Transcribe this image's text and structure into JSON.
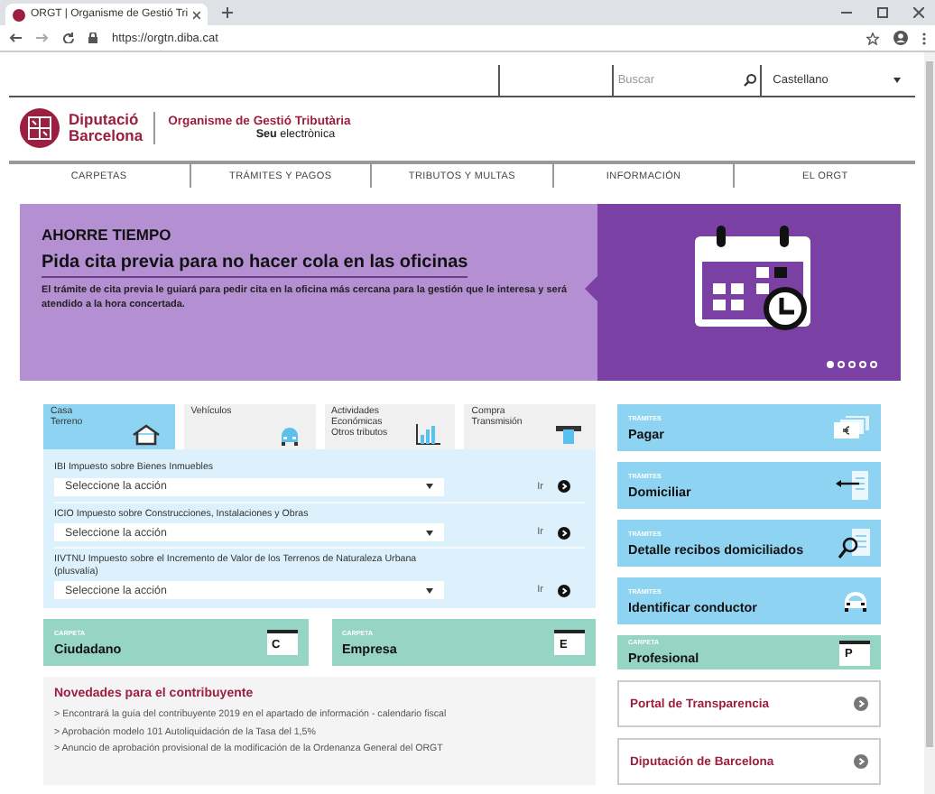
{
  "browser": {
    "tab_title": "ORGT | Organisme de Gestió Tri",
    "url": "https://orgtn.diba.cat"
  },
  "header": {
    "search": {
      "placeholder": "Buscar"
    },
    "language": "Castellano"
  },
  "logo": {
    "line1": "Diputació",
    "line2": "Barcelona",
    "org": "Organisme de Gestió Tributària",
    "seu": "**Seu** electrònica"
  },
  "nav": {
    "items": [
      {
        "label": "CARPETAS"
      },
      {
        "label": "TRÁMITES Y PAGOS"
      },
      {
        "label": "TRIBUTOS Y MULTAS"
      },
      {
        "label": "INFORMACIÓN"
      },
      {
        "label": "EL ORGT"
      }
    ]
  },
  "banner": {
    "kicker": "AHORRE TIEMPO",
    "title": "Pida cita previa para no hacer cola en las oficinas",
    "text": "El trámite de cita previa le guiará para pedir cita en la oficina más cercana para la gestión que le interesa y será atendido a la hora concertada.",
    "dots": [
      {
        "selected": true
      },
      {
        "selected": false
      },
      {
        "selected": false
      },
      {
        "selected": false
      },
      {
        "selected": false
      }
    ]
  },
  "tax_tabs": [
    {
      "lines": [
        "Casa",
        "Terreno"
      ],
      "kind": "house",
      "selected": true
    },
    {
      "lines": [
        "Vehículos"
      ],
      "kind": "car",
      "selected": false
    },
    {
      "lines": [
        "Actividades",
        "Económicas",
        "Otros tributos"
      ],
      "kind": "chart",
      "selected": false
    },
    {
      "lines": [
        "Compra",
        "Transmisión"
      ],
      "kind": "card",
      "selected": false
    }
  ],
  "taxes": [
    {
      "title": "IBI Impuesto sobre Bienes Inmuebles",
      "select": "Seleccione la acción",
      "go": "Ir"
    },
    {
      "title": "ICIO Impuesto sobre Construcciones, Instalaciones y Obras",
      "select": "Seleccione la acción",
      "go": "Ir"
    },
    {
      "title": "IIVTNU Impuesto sobre el Incremento de Valor de los Terrenos de Naturaleza Urbana (plusvalía)",
      "select": "Seleccione la acción",
      "go": "Ir"
    }
  ],
  "carpetas": [
    {
      "category": "CARPETA",
      "label": "Ciudadano",
      "letter": "C"
    },
    {
      "category": "CARPETA",
      "label": "Empresa",
      "letter": "E"
    }
  ],
  "news": {
    "title": "Novedades para el contribuyente",
    "items": [
      "> Encontrará la guía del contribuyente 2019 en el apartado de información - calendario fiscal",
      "> Aprobación modelo 101 Autoliquidación de la Tasa del 1,5%",
      "> Anuncio de aprobación provisional de la modificación de la Ordenanza General del ORGT"
    ]
  },
  "sidebar": {
    "tramites": [
      {
        "category": "TRÁMITES",
        "label": "Pagar",
        "kind": "money"
      },
      {
        "category": "TRÁMITES",
        "label": "Domiciliar",
        "kind": "document-arrow"
      },
      {
        "category": "TRÁMITES",
        "label": "Detalle recibos domiciliados",
        "kind": "document-search"
      },
      {
        "category": "TRÁMITES",
        "label": "Identificar conductor",
        "kind": "car"
      }
    ],
    "carpeta": {
      "category": "CARPETA",
      "label": "Profesional",
      "letter": "P"
    },
    "links": [
      "Portal de Transparencia",
      "Diputación de Barcelona"
    ]
  }
}
